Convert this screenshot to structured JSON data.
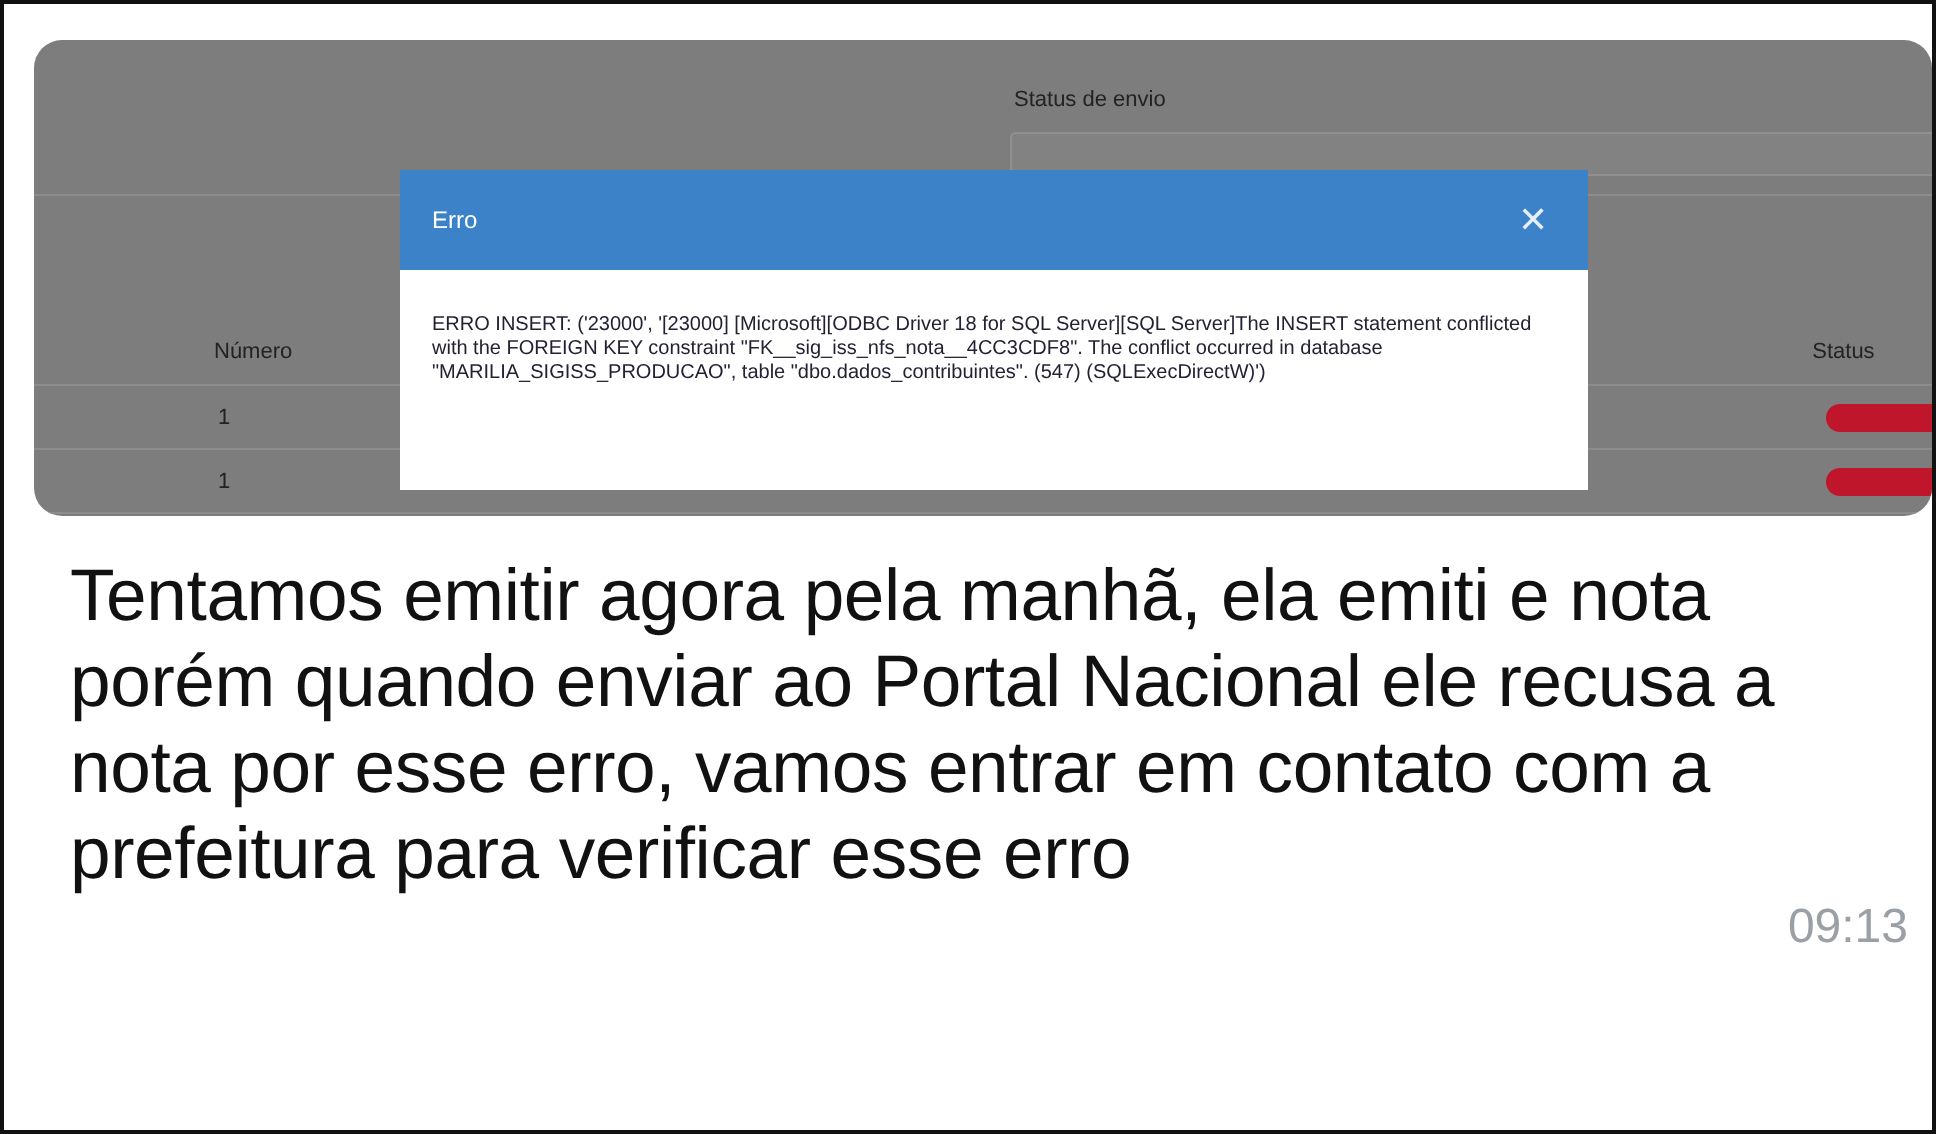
{
  "screenshot": {
    "filter_label": "Status de envio",
    "columns": [
      {
        "label": "Número"
      },
      {
        "label": "Status"
      }
    ],
    "rows": [
      {
        "number": "1",
        "color": "#c0162c"
      },
      {
        "number": "1",
        "color": "#c0162c"
      }
    ],
    "dialog": {
      "title": "Erro",
      "close": "✕",
      "message": "ERRO INSERT: ('23000', '[23000] [Microsoft][ODBC Driver 18 for SQL Server][SQL Server]The INSERT statement conflicted with the FOREIGN KEY constraint \"FK__sig_iss_nfs_nota__4CC3CDF8\". The conflict occurred in database \"MARILIA_SIGISS_PRODUCAO\", table \"dbo.dados_contribuintes\". (547) (SQLExecDirectW)')"
    }
  },
  "message": {
    "text": "Tentamos emitir agora pela manhã, ela emiti e nota porém quando enviar ao Portal Nacional ele recusa a nota por esse erro, vamos entrar em contato com a prefeitura para verificar esse erro",
    "time": "09:13"
  }
}
